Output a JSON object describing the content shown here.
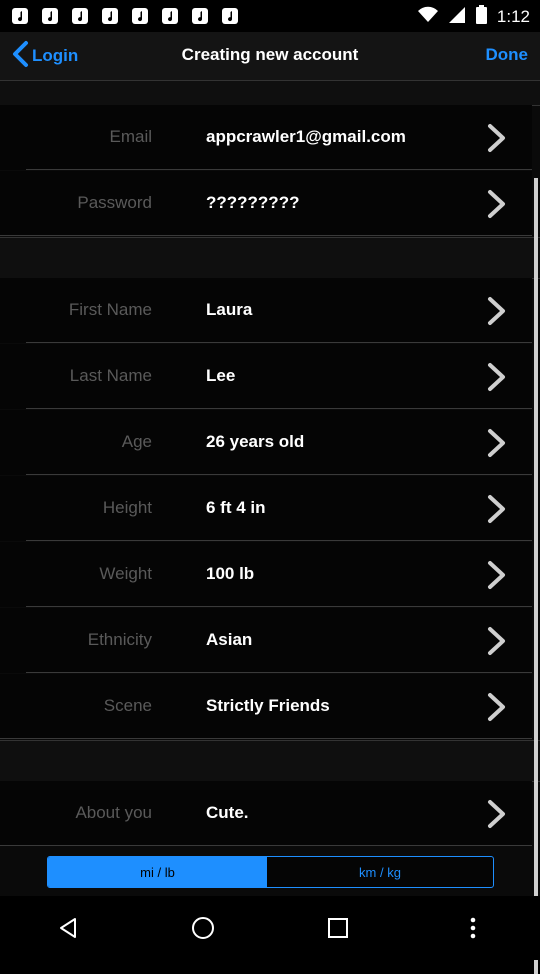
{
  "status": {
    "time": "1:12"
  },
  "nav": {
    "back_label": "Login",
    "title": "Creating new account",
    "done_label": "Done"
  },
  "rows": [
    {
      "label": "Email",
      "value": "appcrawler1@gmail.com"
    },
    {
      "label": "Password",
      "value": "?????????"
    },
    {
      "label": "First Name",
      "value": "Laura"
    },
    {
      "label": "Last Name",
      "value": "Lee"
    },
    {
      "label": "Age",
      "value": "26 years old"
    },
    {
      "label": "Height",
      "value": "6 ft 4 in"
    },
    {
      "label": "Weight",
      "value": "100 lb"
    },
    {
      "label": "Ethnicity",
      "value": "Asian"
    },
    {
      "label": "Scene",
      "value": "Strictly Friends"
    },
    {
      "label": "About you",
      "value": "Cute."
    }
  ],
  "units": {
    "imperial": "mi / lb",
    "metric": "km / kg",
    "selected": "mi / lb"
  },
  "colors": {
    "accent": "#1e8fff",
    "background": "#000000"
  },
  "icons": [
    "music-note-icon",
    "wifi-icon",
    "signal-icon",
    "battery-icon",
    "chevron-left-icon",
    "chevron-right-icon",
    "back-triangle-icon",
    "home-circle-icon",
    "recents-square-icon",
    "overflow-menu-icon"
  ]
}
